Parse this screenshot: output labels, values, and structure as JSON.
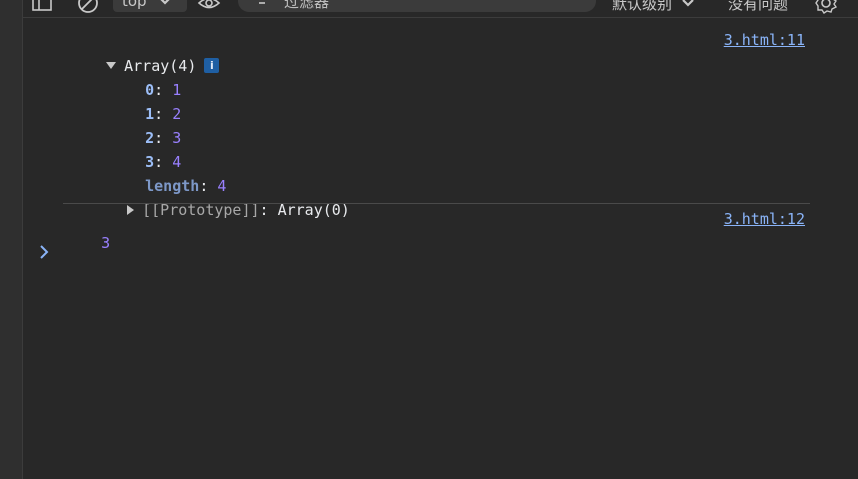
{
  "toolbar": {
    "context_label": "top",
    "filter_placeholder": "过滤器",
    "levels_label": "默认级别",
    "issues_label": "没有问题"
  },
  "console": {
    "entries": [
      {
        "summary": "Array(4)",
        "info_badge": "i",
        "source": "3.html:11",
        "properties": [
          {
            "key": "0",
            "value": "1"
          },
          {
            "key": "1",
            "value": "2"
          },
          {
            "key": "2",
            "value": "3"
          },
          {
            "key": "3",
            "value": "4"
          }
        ],
        "length_key": "length",
        "length_value": "4",
        "prototype_key": "[[Prototype]]",
        "prototype_value": "Array(0)"
      },
      {
        "value": "3",
        "source": "3.html:12"
      }
    ]
  },
  "colors": {
    "background": "#282828",
    "key": "#9cbef7",
    "number": "#9980ff",
    "link": "#8ab4f8",
    "info_badge": "#1f5fa3"
  },
  "icons": [
    "sidebar-icon",
    "clear-console-icon",
    "chevron-down-icon",
    "eye-icon",
    "filter-icon",
    "settings-gear-icon",
    "prompt-chevron-icon",
    "expand-triangle-icon",
    "collapse-triangle-icon",
    "info-icon"
  ]
}
